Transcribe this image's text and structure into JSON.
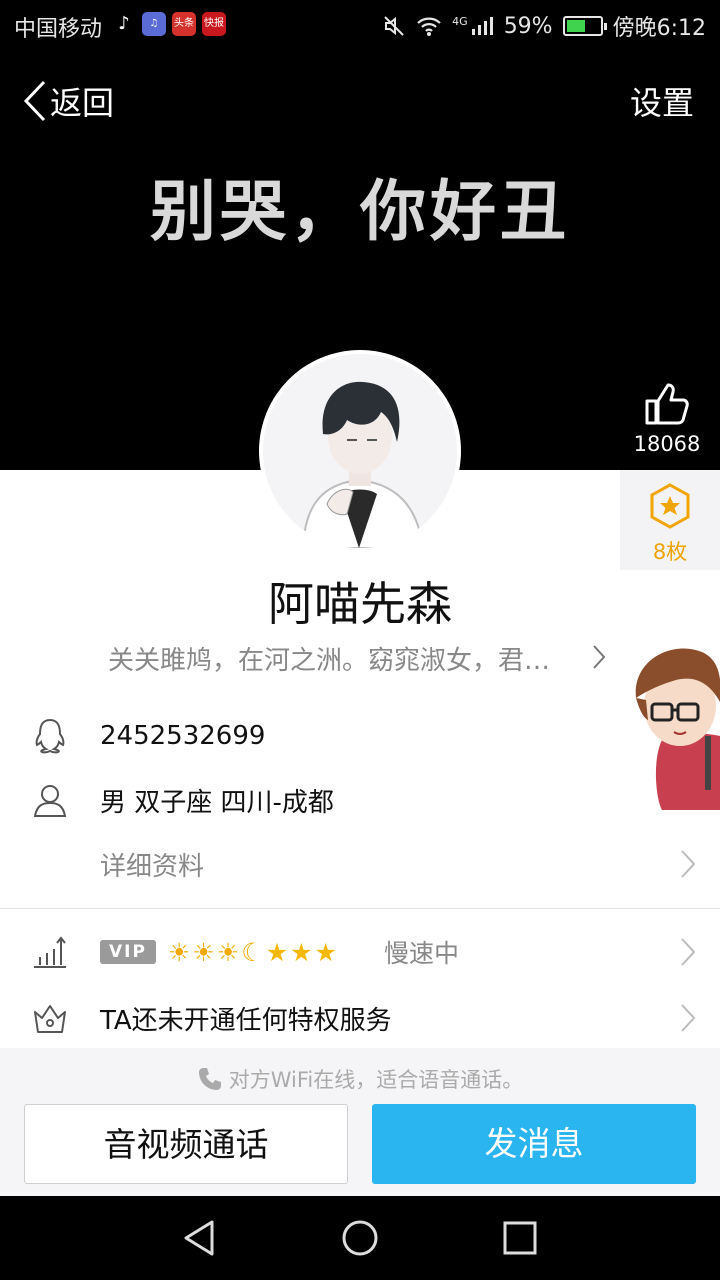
{
  "status_bar": {
    "carrier": "中国移动",
    "app_icons": [
      "tiktok-icon",
      "music-icon",
      "news-icon",
      "hot-news-icon"
    ],
    "app_icon_labels": [
      "♪",
      "♫",
      "头条",
      "快报"
    ],
    "network": "4G",
    "battery_percent": "59%",
    "battery_level": 0.59,
    "time": "傍晚6:12"
  },
  "header": {
    "back_label": "返回",
    "settings_label": "设置",
    "cover_text": "别哭，你好丑"
  },
  "likes": {
    "count": "18068"
  },
  "medal": {
    "count": "8枚"
  },
  "profile": {
    "nickname": "阿喵先森",
    "signature": "关关雎鸠，在河之洲。窈窕淑女，君…",
    "qq_number": "2452532699",
    "basic_info": "男  双子座  四川-成都",
    "details_label": "详细资料"
  },
  "vip": {
    "badge": "VIP",
    "level_icons": [
      "sun",
      "sun",
      "sun",
      "moon",
      "star",
      "star",
      "star"
    ],
    "status": "慢速中"
  },
  "privilege": {
    "text": "TA还未开通任何特权服务"
  },
  "footer": {
    "hint": "对方WiFi在线，适合语音通话。",
    "call_button": "音视频通话",
    "message_button": "发消息"
  },
  "colors": {
    "accent": "#2ab4f0",
    "medal": "#f0a500",
    "cover_bg": "#000000"
  }
}
